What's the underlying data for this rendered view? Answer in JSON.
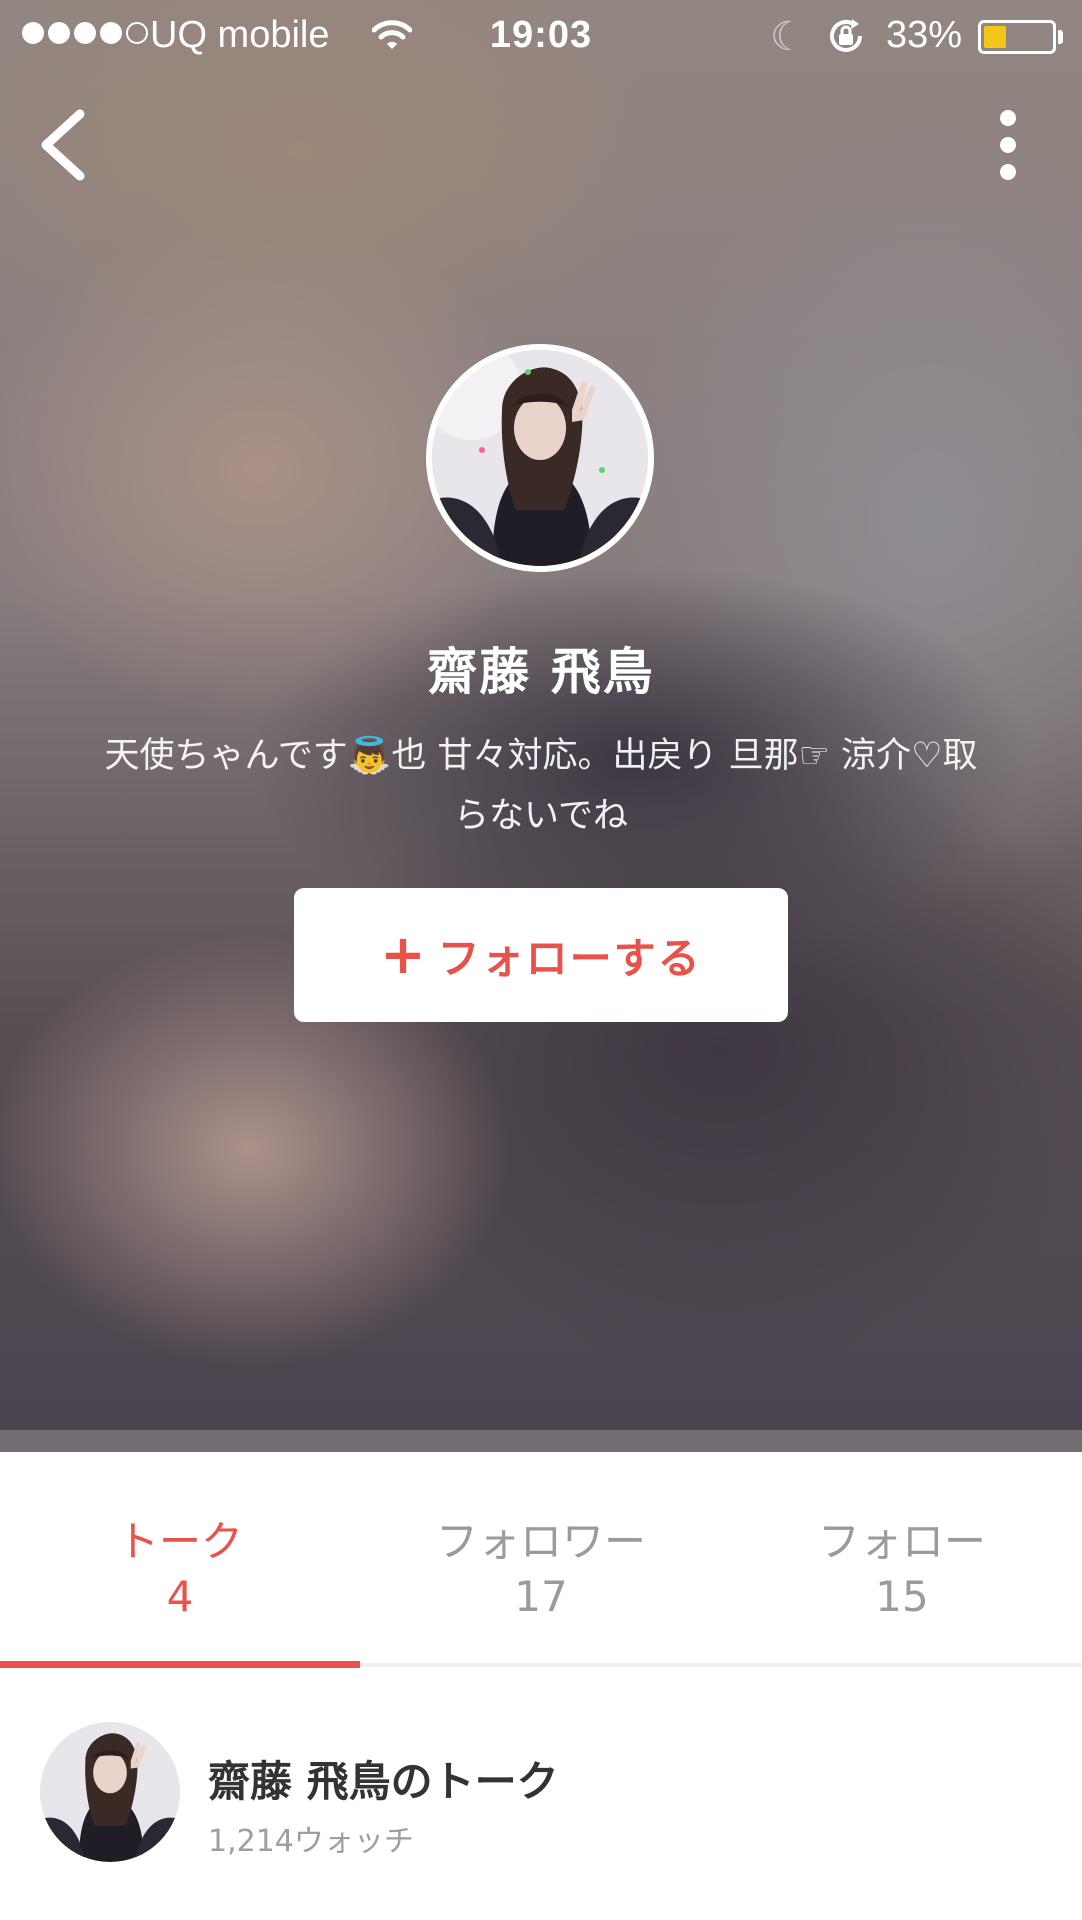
{
  "status_bar": {
    "carrier": "UQ mobile",
    "time": "19:03",
    "battery": "33%",
    "signal_bars": 4,
    "battery_level": 0.33
  },
  "profile": {
    "name": "齋藤 飛鳥",
    "bio_line1": "天使ちゃんです👼也 甘々対応。出戻り 旦那☞ 涼介♡取",
    "bio_line2": "らないでね",
    "follow_label": "フォローする",
    "follow_plus": "+"
  },
  "tabs": [
    {
      "label": "トーク",
      "count": "4",
      "active": true
    },
    {
      "label": "フォロワー",
      "count": "17",
      "active": false
    },
    {
      "label": "フォロー",
      "count": "15",
      "active": false
    }
  ],
  "talk": {
    "title": "齋藤 飛鳥のトーク",
    "watch": "1,214ウォッチ"
  },
  "colors": {
    "accent": "#e9524a",
    "battery": "#f5c518"
  },
  "icons": [
    "chevron-left-icon",
    "more-vertical-icon",
    "wifi-icon",
    "moon-icon",
    "rotation-lock-icon",
    "battery-icon"
  ]
}
